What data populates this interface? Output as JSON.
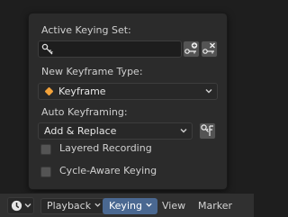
{
  "popup": {
    "active_keying_set_label": "Active Keying Set:",
    "active_keying_set_value": "",
    "new_keyframe_type_label": "New Keyframe Type:",
    "keyframe_type_value": "Keyframe",
    "auto_keyframing_label": "Auto Keyframing:",
    "auto_keyframing_mode": "Add & Replace",
    "layered_recording_label": "Layered Recording",
    "layered_recording_checked": false,
    "cycle_aware_label": "Cycle-Aware Keying",
    "cycle_aware_checked": false
  },
  "header": {
    "menus": [
      {
        "label": "Playback",
        "dropdown": true
      },
      {
        "label": "Keying",
        "dropdown": true,
        "active": true
      },
      {
        "label": "View"
      },
      {
        "label": "Marker"
      }
    ]
  },
  "colors": {
    "accent_active": "#4a6891",
    "keyframe_diamond": "#f2a23a"
  },
  "icons": [
    "key-icon",
    "add-keying-set-icon",
    "remove-keying-set-icon",
    "keyframe-diamond-icon",
    "chevron-down-icon",
    "keying-set-filter-icon",
    "clock-icon"
  ]
}
